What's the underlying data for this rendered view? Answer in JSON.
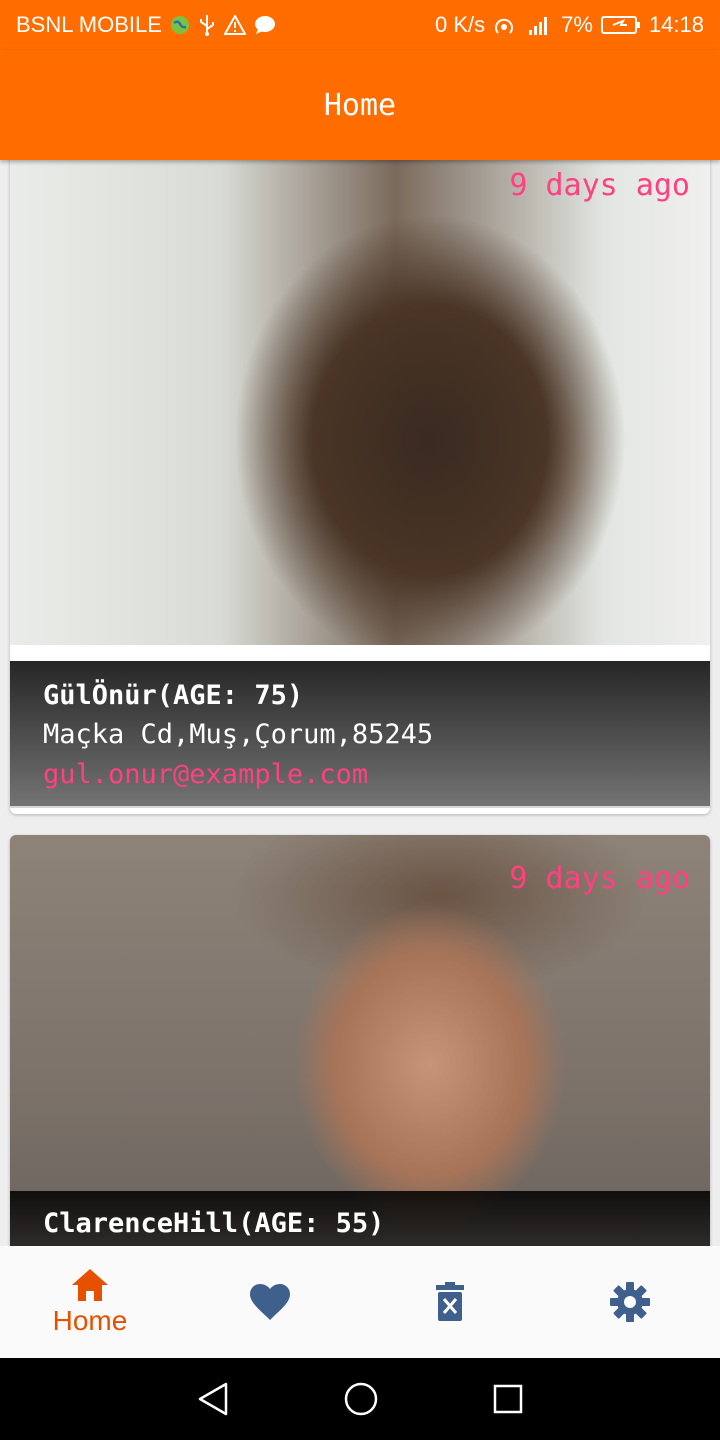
{
  "status_bar": {
    "carrier": "BSNL MOBILE",
    "network_speed": "0 K/s",
    "battery": "7%",
    "time": "14:18"
  },
  "app_bar": {
    "title": "Home"
  },
  "cards": [
    {
      "timestamp": "9 days ago",
      "name": "GülÖnür(AGE: 75)",
      "address": "Maçka Cd,Muş,Çorum,85245",
      "email": "gul.onur@example.com",
      "photo_icon": "person-photo"
    },
    {
      "timestamp": "9 days ago",
      "name": "ClarenceHill(AGE: 55)",
      "photo_icon": "person-photo"
    }
  ],
  "actions": {
    "reject_icon": "close-icon",
    "accept_icon": "check-icon"
  },
  "bottom_nav": {
    "items": [
      {
        "icon": "home-icon",
        "label": "Home",
        "active": true
      },
      {
        "icon": "heart-icon",
        "active": false
      },
      {
        "icon": "delete-icon",
        "active": false
      },
      {
        "icon": "gear-icon",
        "active": false
      }
    ]
  },
  "colors": {
    "primary": "#ff6d00",
    "accent": "#ff4081",
    "accept": "#007000",
    "nav_inactive": "#3f5f8c",
    "nav_active": "#e65100"
  }
}
